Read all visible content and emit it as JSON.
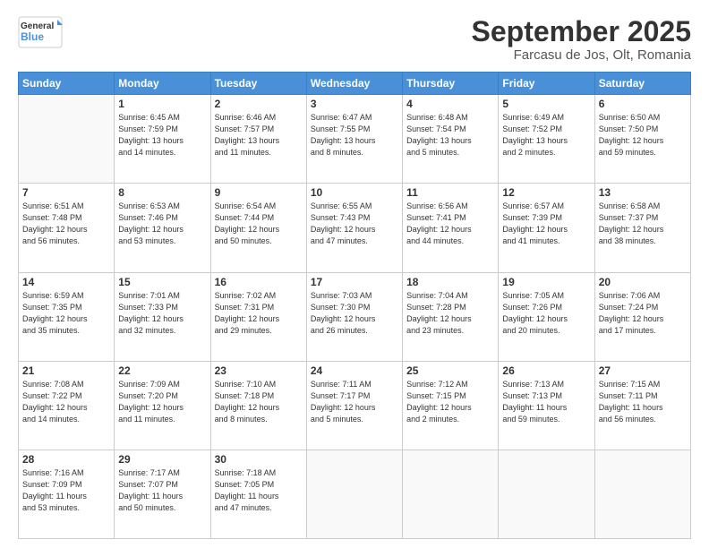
{
  "header": {
    "logo": {
      "line1": "General",
      "line2": "Blue"
    },
    "title": "September 2025",
    "subtitle": "Farcasu de Jos, Olt, Romania"
  },
  "days_of_week": [
    "Sunday",
    "Monday",
    "Tuesday",
    "Wednesday",
    "Thursday",
    "Friday",
    "Saturday"
  ],
  "weeks": [
    [
      {
        "num": "",
        "info": ""
      },
      {
        "num": "1",
        "info": "Sunrise: 6:45 AM\nSunset: 7:59 PM\nDaylight: 13 hours\nand 14 minutes."
      },
      {
        "num": "2",
        "info": "Sunrise: 6:46 AM\nSunset: 7:57 PM\nDaylight: 13 hours\nand 11 minutes."
      },
      {
        "num": "3",
        "info": "Sunrise: 6:47 AM\nSunset: 7:55 PM\nDaylight: 13 hours\nand 8 minutes."
      },
      {
        "num": "4",
        "info": "Sunrise: 6:48 AM\nSunset: 7:54 PM\nDaylight: 13 hours\nand 5 minutes."
      },
      {
        "num": "5",
        "info": "Sunrise: 6:49 AM\nSunset: 7:52 PM\nDaylight: 13 hours\nand 2 minutes."
      },
      {
        "num": "6",
        "info": "Sunrise: 6:50 AM\nSunset: 7:50 PM\nDaylight: 12 hours\nand 59 minutes."
      }
    ],
    [
      {
        "num": "7",
        "info": "Sunrise: 6:51 AM\nSunset: 7:48 PM\nDaylight: 12 hours\nand 56 minutes."
      },
      {
        "num": "8",
        "info": "Sunrise: 6:53 AM\nSunset: 7:46 PM\nDaylight: 12 hours\nand 53 minutes."
      },
      {
        "num": "9",
        "info": "Sunrise: 6:54 AM\nSunset: 7:44 PM\nDaylight: 12 hours\nand 50 minutes."
      },
      {
        "num": "10",
        "info": "Sunrise: 6:55 AM\nSunset: 7:43 PM\nDaylight: 12 hours\nand 47 minutes."
      },
      {
        "num": "11",
        "info": "Sunrise: 6:56 AM\nSunset: 7:41 PM\nDaylight: 12 hours\nand 44 minutes."
      },
      {
        "num": "12",
        "info": "Sunrise: 6:57 AM\nSunset: 7:39 PM\nDaylight: 12 hours\nand 41 minutes."
      },
      {
        "num": "13",
        "info": "Sunrise: 6:58 AM\nSunset: 7:37 PM\nDaylight: 12 hours\nand 38 minutes."
      }
    ],
    [
      {
        "num": "14",
        "info": "Sunrise: 6:59 AM\nSunset: 7:35 PM\nDaylight: 12 hours\nand 35 minutes."
      },
      {
        "num": "15",
        "info": "Sunrise: 7:01 AM\nSunset: 7:33 PM\nDaylight: 12 hours\nand 32 minutes."
      },
      {
        "num": "16",
        "info": "Sunrise: 7:02 AM\nSunset: 7:31 PM\nDaylight: 12 hours\nand 29 minutes."
      },
      {
        "num": "17",
        "info": "Sunrise: 7:03 AM\nSunset: 7:30 PM\nDaylight: 12 hours\nand 26 minutes."
      },
      {
        "num": "18",
        "info": "Sunrise: 7:04 AM\nSunset: 7:28 PM\nDaylight: 12 hours\nand 23 minutes."
      },
      {
        "num": "19",
        "info": "Sunrise: 7:05 AM\nSunset: 7:26 PM\nDaylight: 12 hours\nand 20 minutes."
      },
      {
        "num": "20",
        "info": "Sunrise: 7:06 AM\nSunset: 7:24 PM\nDaylight: 12 hours\nand 17 minutes."
      }
    ],
    [
      {
        "num": "21",
        "info": "Sunrise: 7:08 AM\nSunset: 7:22 PM\nDaylight: 12 hours\nand 14 minutes."
      },
      {
        "num": "22",
        "info": "Sunrise: 7:09 AM\nSunset: 7:20 PM\nDaylight: 12 hours\nand 11 minutes."
      },
      {
        "num": "23",
        "info": "Sunrise: 7:10 AM\nSunset: 7:18 PM\nDaylight: 12 hours\nand 8 minutes."
      },
      {
        "num": "24",
        "info": "Sunrise: 7:11 AM\nSunset: 7:17 PM\nDaylight: 12 hours\nand 5 minutes."
      },
      {
        "num": "25",
        "info": "Sunrise: 7:12 AM\nSunset: 7:15 PM\nDaylight: 12 hours\nand 2 minutes."
      },
      {
        "num": "26",
        "info": "Sunrise: 7:13 AM\nSunset: 7:13 PM\nDaylight: 11 hours\nand 59 minutes."
      },
      {
        "num": "27",
        "info": "Sunrise: 7:15 AM\nSunset: 7:11 PM\nDaylight: 11 hours\nand 56 minutes."
      }
    ],
    [
      {
        "num": "28",
        "info": "Sunrise: 7:16 AM\nSunset: 7:09 PM\nDaylight: 11 hours\nand 53 minutes."
      },
      {
        "num": "29",
        "info": "Sunrise: 7:17 AM\nSunset: 7:07 PM\nDaylight: 11 hours\nand 50 minutes."
      },
      {
        "num": "30",
        "info": "Sunrise: 7:18 AM\nSunset: 7:05 PM\nDaylight: 11 hours\nand 47 minutes."
      },
      {
        "num": "",
        "info": ""
      },
      {
        "num": "",
        "info": ""
      },
      {
        "num": "",
        "info": ""
      },
      {
        "num": "",
        "info": ""
      }
    ]
  ]
}
